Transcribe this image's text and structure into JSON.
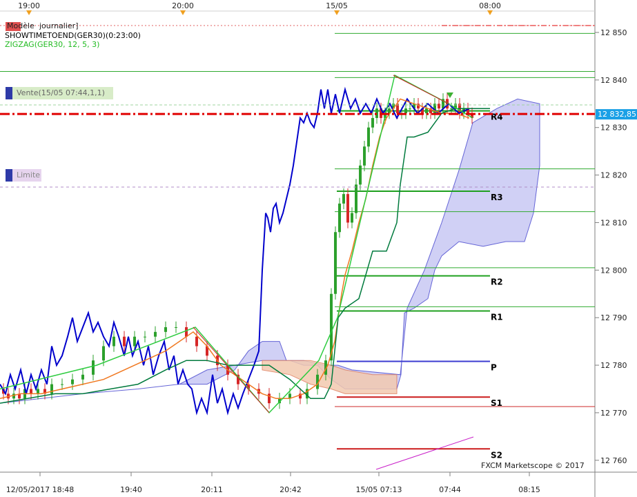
{
  "window": {
    "top_time_labels": [
      "19:00",
      "20:00",
      "15/05",
      "08:00"
    ],
    "bottom_time_labels": [
      "12/05/2017 18:48",
      "19:40",
      "20:11",
      "20:42",
      "15/05 07:13",
      "07:44",
      "08:15"
    ],
    "indicator_lines": [
      "journalier]",
      "SHOWTIMETOEND(GER30)(0:23:00)",
      "ZIGZAG(GER30, 12, 5, 3)"
    ],
    "modele_tag": "Modèle",
    "order_sell_label": "Vente(15/05 07:44,1,1)",
    "order_limit_label": "Limite",
    "current_price_label": "12 832,85",
    "watermark": "FXCM Marketscope © 2017"
  },
  "pivots": {
    "labels": [
      "R4",
      "R3",
      "R2",
      "R1",
      "P",
      "S1",
      "S2"
    ],
    "values": [
      12833.5,
      12816.6,
      12798.8,
      12791.4,
      12780.8,
      12773.3,
      12762.4
    ]
  },
  "chart_data": {
    "type": "line",
    "instrument": "GER30",
    "ylim": [
      12757.5,
      12854.5
    ],
    "y_ticks": [
      12760,
      12770,
      12780,
      12790,
      12800,
      12810,
      12820,
      12830,
      12840,
      12850
    ],
    "y_tick_labels": [
      "12 760",
      "12 770",
      "12 780",
      "12 790",
      "12 800",
      "12 810",
      "12 820",
      "12 830",
      "12 840",
      "12 850"
    ],
    "current_price": 12832.85,
    "horizontal_levels": [
      12849.8,
      12841.8,
      12840.5,
      12821.3,
      12812.3,
      12800.5,
      12792.3,
      12771.3
    ],
    "pivot_line_color": "#2e8b2e",
    "series": [
      {
        "color": "#0000cc",
        "x": [
          0,
          8,
          15,
          22,
          30,
          38,
          45,
          52,
          60,
          68,
          75,
          82,
          90,
          98,
          105,
          112,
          120,
          128,
          135,
          142,
          150,
          158,
          165,
          172,
          180,
          186,
          192,
          200,
          208,
          215,
          222,
          230,
          238,
          245,
          252,
          258,
          265,
          272,
          278,
          285,
          292,
          300,
          308,
          315,
          322,
          330,
          338,
          345,
          352,
          360,
          368,
          375,
          380,
          385,
          388,
          392,
          396,
          400,
          405,
          410,
          415,
          420,
          425,
          430,
          435,
          440,
          445,
          450,
          455,
          460,
          465,
          470,
          475,
          480,
          486,
          492,
          500,
          508,
          515,
          522,
          530,
          538,
          546,
          555,
          565,
          575,
          590,
          605,
          620,
          635,
          650,
          665,
          680
        ],
        "y": [
          12776,
          12774,
          12778,
          12775,
          12779,
          12774,
          12778,
          12775,
          12779,
          12776,
          12784,
          12780,
          12782,
          12786,
          12790,
          12785,
          12788,
          12791,
          12787,
          12789,
          12786,
          12784,
          12789,
          12786,
          12782,
          12786,
          12782,
          12785,
          12780,
          12784,
          12778,
          12782,
          12785,
          12779,
          12782,
          12776,
          12779,
          12776,
          12775,
          12770,
          12773,
          12770,
          12778,
          12772,
          12775,
          12770,
          12774,
          12771,
          12774,
          12777,
          12780,
          12783,
          12800,
          12812,
          12811,
          12808,
          12813,
          12814,
          12810,
          12812,
          12815,
          12818,
          12822,
          12827,
          12832,
          12831,
          12833,
          12831,
          12830,
          12833,
          12838,
          12834,
          12838,
          12833,
          12837,
          12833,
          12838,
          12834,
          12836,
          12833,
          12835,
          12833,
          12836,
          12833,
          12835,
          12832,
          12836,
          12833,
          12835,
          12833,
          12835,
          12833,
          12834
        ]
      },
      {
        "color": "#f07820",
        "x": [
          0,
          30,
          60,
          90,
          120,
          150,
          180,
          210,
          240,
          260,
          280,
          300,
          320,
          340,
          360,
          380,
          400,
          420,
          440,
          460,
          475,
          485,
          490,
          495,
          500,
          510,
          520,
          530,
          540,
          550,
          560,
          570,
          580,
          600,
          620,
          640,
          660,
          680
        ],
        "y": [
          12773,
          12774,
          12774,
          12775,
          12776,
          12777,
          12779,
          12781,
          12783,
          12785,
          12787,
          12784,
          12780,
          12778,
          12776,
          12774,
          12773,
          12773,
          12774,
          12776,
          12780,
          12785,
          12790,
          12795,
          12799,
          12804,
          12810,
          12815,
          12822,
          12828,
          12832,
          12834,
          12836,
          12835,
          12834,
          12833,
          12833,
          12832
        ]
      },
      {
        "color": "#007a3d",
        "x": [
          0,
          40,
          80,
          120,
          160,
          200,
          240,
          270,
          300,
          330,
          360,
          390,
          420,
          450,
          470,
          480,
          490,
          500,
          520,
          540,
          560,
          575,
          580,
          590,
          600,
          620,
          640,
          660,
          680,
          710
        ],
        "y": [
          12772,
          12773,
          12774,
          12774,
          12775,
          12776,
          12779,
          12781,
          12781,
          12780,
          12780,
          12780,
          12777,
          12773,
          12773,
          12776,
          12790,
          12792,
          12794,
          12804,
          12804,
          12810,
          12818,
          12828,
          12828,
          12829,
          12833,
          12834,
          12834,
          12834
        ]
      },
      {
        "color": "#2ecc40",
        "x": [
          0,
          140,
          283,
          390,
          462,
          489,
          572,
          650,
          685
        ],
        "y": [
          12775,
          12780,
          12788,
          12770,
          12781,
          12790,
          12841,
          12835,
          12832
        ]
      }
    ],
    "candles": {
      "up_color": "#2ca02c",
      "down_color": "#d62728",
      "x": [
        5,
        12,
        20,
        28,
        36,
        45,
        55,
        65,
        75,
        90,
        105,
        120,
        135,
        150,
        165,
        180,
        195,
        210,
        225,
        240,
        255,
        270,
        285,
        300,
        315,
        330,
        345,
        360,
        375,
        390,
        405,
        420,
        435,
        445,
        460,
        472,
        480,
        486,
        492,
        498,
        504,
        510,
        516,
        522,
        528,
        534,
        540,
        546,
        552,
        558,
        564,
        570,
        576,
        582,
        588,
        594,
        600,
        606,
        612,
        618,
        624,
        630,
        636,
        642,
        648,
        654,
        660,
        666,
        672,
        678,
        684
      ],
      "open": [
        12775,
        12774,
        12773,
        12774,
        12773,
        12775,
        12774,
        12775,
        12774,
        12776,
        12776,
        12777,
        12778,
        12781,
        12784,
        12786,
        12784,
        12786,
        12786,
        12787,
        12788,
        12788,
        12786,
        12784,
        12782,
        12780,
        12778,
        12776,
        12775,
        12774,
        12772,
        12773,
        12774,
        12773,
        12775,
        12778,
        12781,
        12795,
        12808,
        12814,
        12816,
        12810,
        12812,
        12818,
        12822,
        12826,
        12830,
        12832,
        12834,
        12832,
        12833,
        12834,
        12835,
        12833,
        12833,
        12834,
        12834,
        12835,
        12834,
        12833,
        12834,
        12833,
        12835,
        12834,
        12836,
        12834,
        12834,
        12835,
        12833,
        12834,
        12833
      ],
      "close": [
        12774,
        12773,
        12774,
        12773,
        12775,
        12774,
        12775,
        12774,
        12776,
        12776,
        12777,
        12778,
        12781,
        12784,
        12786,
        12784,
        12786,
        12786,
        12787,
        12788,
        12788,
        12786,
        12784,
        12782,
        12780,
        12778,
        12776,
        12775,
        12774,
        12772,
        12773,
        12774,
        12773,
        12775,
        12778,
        12781,
        12795,
        12808,
        12814,
        12816,
        12810,
        12812,
        12818,
        12822,
        12826,
        12830,
        12832,
        12834,
        12832,
        12833,
        12834,
        12835,
        12833,
        12833,
        12834,
        12834,
        12835,
        12834,
        12833,
        12834,
        12833,
        12835,
        12834,
        12836,
        12834,
        12834,
        12835,
        12833,
        12834,
        12833,
        12832
      ]
    }
  }
}
